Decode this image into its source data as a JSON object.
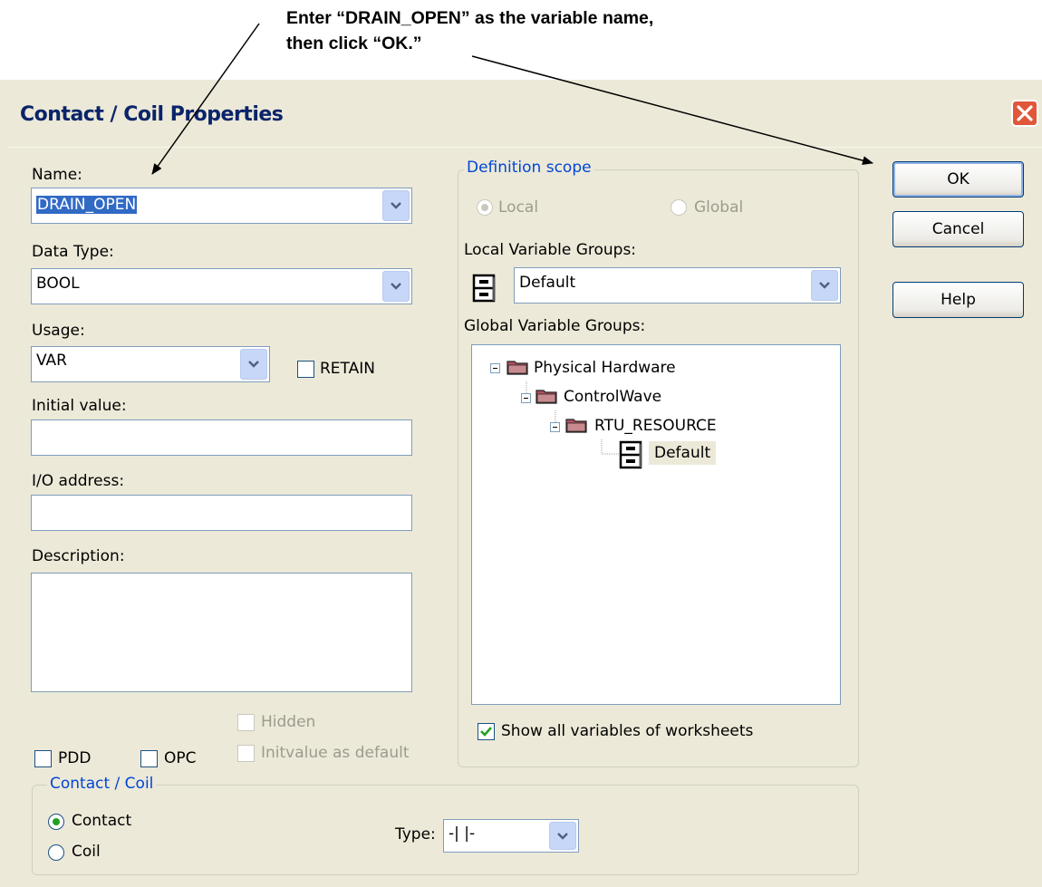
{
  "annotation": {
    "line1": "Enter “DRAIN_OPEN” as the variable name,",
    "line2": "then click “OK.”"
  },
  "dialog": {
    "title": "Contact / Coil Properties",
    "close_icon": "close-icon"
  },
  "left": {
    "name_label": "Name:",
    "name_value": "DRAIN_OPEN",
    "datatype_label": "Data Type:",
    "datatype_value": "BOOL",
    "usage_label": "Usage:",
    "usage_value": "VAR",
    "retain_label": "RETAIN",
    "initial_label": "Initial value:",
    "initial_value": "",
    "io_label": "I/O address:",
    "io_value": "",
    "desc_label": "Description:",
    "desc_value": "",
    "pdd_label": "PDD",
    "opc_label": "OPC",
    "hidden_label": "Hidden",
    "initvalue_label": "Initvalue as default"
  },
  "scope": {
    "group_label": "Definition scope",
    "local_label": "Local",
    "global_label": "Global",
    "local_groups_label": "Local Variable Groups:",
    "local_group_value": "Default",
    "global_groups_label": "Global Variable Groups:",
    "tree": {
      "root": "Physical Hardware",
      "child": "ControlWave",
      "grandchild": "RTU_RESOURCE",
      "leaf": "Default"
    },
    "show_all_label": "Show all variables of worksheets"
  },
  "contact_coil": {
    "group_label": "Contact / Coil",
    "contact_label": "Contact",
    "coil_label": "Coil",
    "type_label": "Type:",
    "type_value": "-| |-"
  },
  "buttons": {
    "ok": "OK",
    "cancel": "Cancel",
    "help": "Help"
  },
  "colors": {
    "dialog_bg": "#ece9d8",
    "title_text": "#0a246a",
    "group_label": "#0046d5",
    "close_button": "#e0573a",
    "selection": "#316ac5",
    "checkmark": "#21a121"
  }
}
